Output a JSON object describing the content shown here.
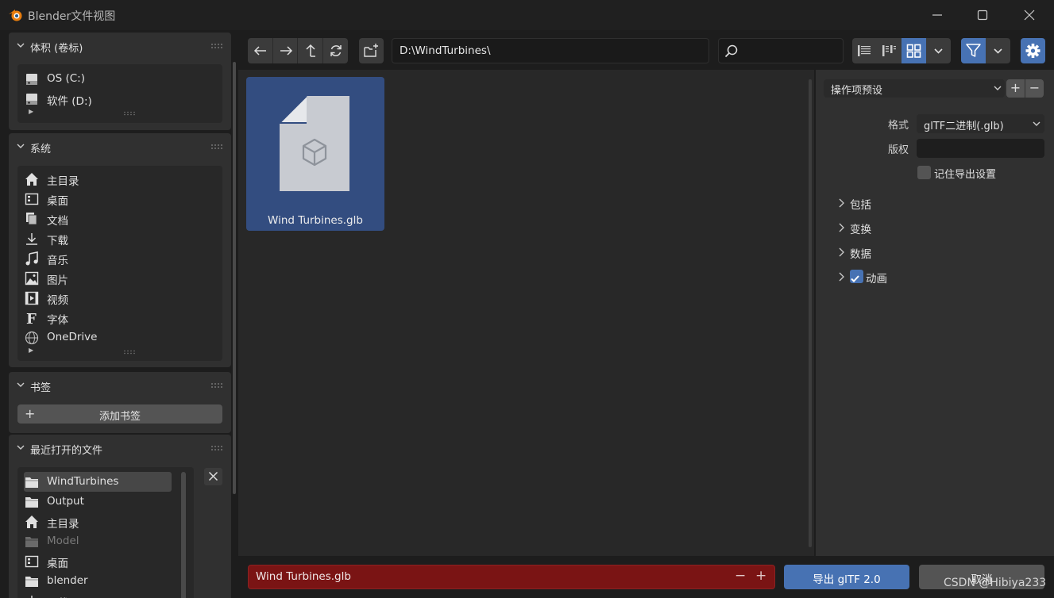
{
  "window": {
    "title": "Blender文件视图",
    "controls": [
      "minimize-icon",
      "maximize-icon",
      "close-icon"
    ]
  },
  "sidebar": {
    "volumes": {
      "title": "体积 (卷标)",
      "items": [
        {
          "label": "OS (C:)",
          "icon": "drive-icon"
        },
        {
          "label": "软件 (D:)",
          "icon": "drive-icon"
        }
      ]
    },
    "system": {
      "title": "系统",
      "items": [
        {
          "label": "主目录",
          "icon": "home-icon"
        },
        {
          "label": "桌面",
          "icon": "desktop-icon"
        },
        {
          "label": "文档",
          "icon": "documents-icon"
        },
        {
          "label": "下载",
          "icon": "download-icon"
        },
        {
          "label": "音乐",
          "icon": "music-icon"
        },
        {
          "label": "图片",
          "icon": "image-icon"
        },
        {
          "label": "视频",
          "icon": "video-icon"
        },
        {
          "label": "字体",
          "icon": "font-icon"
        },
        {
          "label": "OneDrive",
          "icon": "globe-icon"
        }
      ]
    },
    "bookmarks": {
      "title": "书签",
      "add_label": "添加书签"
    },
    "recent": {
      "title": "最近打开的文件",
      "items": [
        {
          "label": "WindTurbines",
          "icon": "folder-icon",
          "active": true
        },
        {
          "label": "Output",
          "icon": "folder-icon"
        },
        {
          "label": "主目录",
          "icon": "home-icon"
        },
        {
          "label": "Model",
          "icon": "folder-icon",
          "dim": true
        },
        {
          "label": "桌面",
          "icon": "desktop-icon"
        },
        {
          "label": "blender",
          "icon": "folder-icon"
        },
        {
          "label": "下载",
          "icon": "download-icon"
        }
      ]
    }
  },
  "toolbar": {
    "path": "D:\\WindTurbines\\",
    "search_value": "",
    "view_mode": "thumbnails"
  },
  "files": [
    {
      "name": "Wind Turbines.glb",
      "selected": true,
      "icon": "3d-file-icon"
    }
  ],
  "settings": {
    "preset_label": "操作项预设",
    "format_label": "格式",
    "format_value": "glTF二进制(.glb)",
    "copyright_label": "版权",
    "copyright_value": "",
    "remember_label": "记住导出设置",
    "remember_checked": false,
    "sections": [
      {
        "label": "包括",
        "checkbox": false
      },
      {
        "label": "变换",
        "checkbox": false
      },
      {
        "label": "数据",
        "checkbox": false
      },
      {
        "label": "动画",
        "checkbox": true,
        "checked": true
      }
    ]
  },
  "footer": {
    "filename": "Wind Turbines.glb",
    "export_label": "导出 glTF 2.0",
    "cancel_label": "取消",
    "watermark": "CSDN @Hibiya233"
  },
  "colors": {
    "accent": "#4772b3",
    "filename_error_bg": "#7a1414",
    "selected_file_bg": "#334d80"
  }
}
